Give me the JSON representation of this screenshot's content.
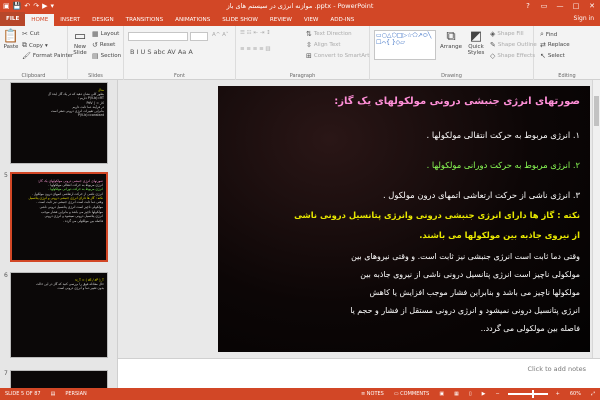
{
  "window": {
    "title": "موازنه انرژی در سیستم های باز .pptx - PowerPoint",
    "qat_icons": [
      "powerpoint-icon",
      "save-icon",
      "undo-icon",
      "redo-icon",
      "start-slideshow-icon",
      "customize-icon"
    ],
    "controls": {
      "help": "?",
      "restore": "▭",
      "minimize": "—",
      "maximize": "□",
      "close": "✕"
    }
  },
  "tabs": [
    {
      "label": "FILE",
      "type": "file"
    },
    {
      "label": "HOME",
      "type": "active"
    },
    {
      "label": "INSERT"
    },
    {
      "label": "DESIGN"
    },
    {
      "label": "TRANSITIONS"
    },
    {
      "label": "ANIMATIONS"
    },
    {
      "label": "SLIDE SHOW"
    },
    {
      "label": "REVIEW"
    },
    {
      "label": "VIEW"
    },
    {
      "label": "ADD-INS"
    }
  ],
  "signin": "Sign in",
  "ribbon": {
    "clipboard": {
      "label": "Clipboard",
      "paste": "Paste",
      "cut": "Cut",
      "copy": "Copy",
      "format_painter": "Format Painter"
    },
    "slides": {
      "label": "Slides",
      "new_slide": "New Slide",
      "layout": "Layout",
      "reset": "Reset",
      "section": "Section"
    },
    "font": {
      "label": "Font",
      "font_name": "",
      "font_size": "",
      "format_glyphs": "B I U S abc AV Aa A"
    },
    "paragraph": {
      "label": "Paragraph",
      "text_direction": "Text Direction",
      "align_text": "Align Text",
      "convert_smartart": "Convert to SmartArt"
    },
    "drawing": {
      "label": "Drawing",
      "arrange": "Arrange",
      "quick_styles": "Quick Styles",
      "shape_fill": "Shape Fill",
      "shape_outline": "Shape Outline",
      "shape_effects": "Shape Effects",
      "shapes_gallery": "▭○△⬡□▷☆⬠↗⬭╲☐⌒{ }◇▱"
    },
    "editing": {
      "label": "Editing",
      "find": "Find",
      "replace": "Replace",
      "select": "Select"
    }
  },
  "thumbnails": [
    {
      "number": "",
      "lines": [
        {
          "text": "مثال",
          "color": "y"
        },
        {
          "text": "بطور کلی نشان دهید که در یک گاز ایده آل",
          "color": "w"
        },
        {
          "text": "P(V-b)=RT داریم :",
          "color": "w"
        },
        {
          "text": "کار = ∫ PdV",
          "color": "w"
        },
        {
          "text": "در فرآیند دما ثابت داریم",
          "color": "w"
        },
        {
          "text": "بنابراین تغییرات انرژی درونی صفر است",
          "color": "w"
        },
        {
          "text": "P(V-b)=constant",
          "color": "w"
        }
      ]
    },
    {
      "number": "5",
      "lines": [
        {
          "text": "صورتهای انرژی جنبشی درونی مولکولهای یک گاز:",
          "color": "p"
        },
        {
          "text": "انرژی مربوط به حرکت انتقالی مولکولها .",
          "color": "w"
        },
        {
          "text": "انرژی مربوط به حرکت دورانی مولکولها .",
          "color": "g"
        },
        {
          "text": "انرژی ناشی از حرکت ارتعاشی اتمهای درون مولکول .",
          "color": "w"
        },
        {
          "text": "نکته : گاز ها دارای انرژی جنبشی درونی و انرژی پتانسیل",
          "color": "y"
        },
        {
          "text": "وقتی دما ثابت است انرژی جنبشی نیز ثابت است .",
          "color": "w"
        },
        {
          "text": "مولکولی ناچیز است انرژی پتانسیل درونی ناشی",
          "color": "w"
        },
        {
          "text": "مولکولها ناچیز می باشد و بنابراین فشار موجب",
          "color": "w"
        },
        {
          "text": "انرژی پتانسیل درونی نمیشود و انرژی درونی",
          "color": "w"
        },
        {
          "text": "فاصله بین مولکولی می گردد .",
          "color": "w"
        }
      ]
    },
    {
      "number": "6",
      "lines": [
        {
          "text": "u_T = ( ∂E / ∂P )_T",
          "color": "y"
        },
        {
          "text": "",
          "color": "w"
        },
        {
          "text": "حال معادله فوق را بررسی کنید که گاز در این حالت",
          "color": "w"
        },
        {
          "text": "بدون تغییر دما و انرژی درونی است",
          "color": "w"
        }
      ]
    },
    {
      "number": "7",
      "lines": []
    }
  ],
  "slide": {
    "title": "صورتهای انرژی جنبشی درونی مولکولهای یک گاز:",
    "item1": "۱. انرژی مربوط به حرکت انتقالی مولکولها .",
    "item2": "۲. انرژی مربوط به حرکت دورانی مولکولها .",
    "item3": "۳. انرژی ناشی از حرکت ارتعاشی اتمهای درون مولکول .",
    "note1": "نکته : گاز ها دارای انرژی جنبشی درونی وانرژی پتانسیل درونی ناشی",
    "note2": "از نیروی جاذبه بین مولکولها می باشند.",
    "body": [
      "وقتی دما ثابت است انرژی جنبشی نیز ثابت است. و وقتی نیروهای بین",
      "مولکولی ناچیز است انرژی پتانسیل درونی ناشی از نیروی جاذبه بین",
      "مولکولها ناچیز می باشد و بنابراین فشار موجب افزایش یا کاهش",
      "انرژی پتانسیل درونی نمیشود و انرژی درونی مستقل از فشار و حجم یا",
      "فاصله بین مولکولی می گردد.."
    ]
  },
  "notes_placeholder": "Click to add notes",
  "status": {
    "slide_info": "SLIDE 5 OF 87",
    "language": "PERSIAN",
    "notes": "NOTES",
    "comments": "COMMENTS",
    "zoom": "60%"
  },
  "colors": {
    "accent": "#d24726",
    "slide_title": "#ff8fd8",
    "slide_green": "#8cff56",
    "slide_yellow": "#e8e800"
  }
}
